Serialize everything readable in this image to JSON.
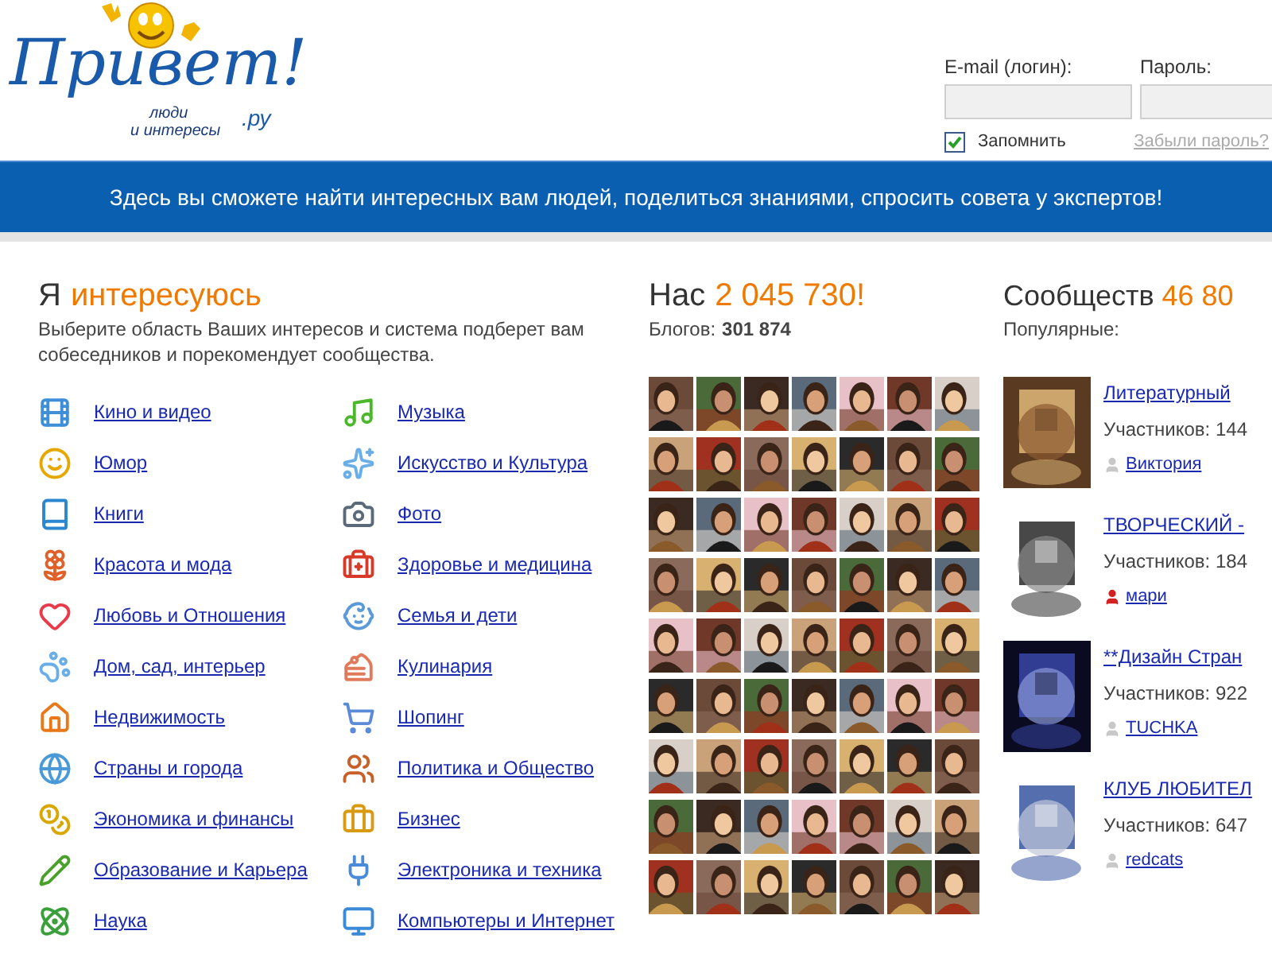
{
  "logo": {
    "wordmark": "Привет!",
    "tagline_lines": [
      "люди",
      "и интересы"
    ],
    "domain": ".ру"
  },
  "login": {
    "email_label": "E-mail (логин):",
    "password_label": "Пароль:",
    "remember": {
      "label": "Запомнить",
      "checked": true
    },
    "forgot_link": "Забыли пароль?"
  },
  "banner": "Здесь вы сможете найти интересных вам людей, поделиться знаниями, спросить совета у экспертов!",
  "interests": {
    "title_plain": "Я",
    "title_accent": "интересуюсь",
    "description": "Выберите область Ваших интересов и система подберет вам собеседников и порекомендует сообщества.",
    "columns": [
      [
        "Кино и видео",
        "Юмор",
        "Книги",
        "Красота и мода",
        "Любовь и Отношения",
        "Дом, сад, интерьер",
        "Недвижимость",
        "Страны и города",
        "Экономика и финансы",
        "Образование и Карьера",
        "Наука"
      ],
      [
        "Музыка",
        "Искусство и Культура",
        "Фото",
        "Здоровье и медицина",
        "Семья и дети",
        "Кулинария",
        "Шопинг",
        "Политика и Общество",
        "Бизнес",
        "Электроника и техника",
        "Компьютеры и Интернет"
      ]
    ]
  },
  "members": {
    "title_plain": "Нас",
    "count": "2 045 730!",
    "blogs_label": "Блогов:",
    "blogs_count": "301 874"
  },
  "communities": {
    "title_plain": "Сообществ",
    "count": "46 80",
    "subtitle": "Популярные:",
    "items": [
      {
        "name": "Литературный",
        "members": "Участников: 144",
        "owner": "Виктория",
        "color": "#c8c8c8"
      },
      {
        "name": "ТВОРЧЕСКИЙ -",
        "members": "Участников: 184",
        "owner": "мари",
        "color": "#d42020"
      },
      {
        "name": "**Дизайн Стран",
        "members": "Участников: 922",
        "owner": "TUCHKA",
        "color": "#c8c8c8"
      },
      {
        "name": "КЛУБ ЛЮБИТЕЛ",
        "members": "Участников: 647",
        "owner": "redcats",
        "color": "#c8c8c8"
      }
    ]
  }
}
